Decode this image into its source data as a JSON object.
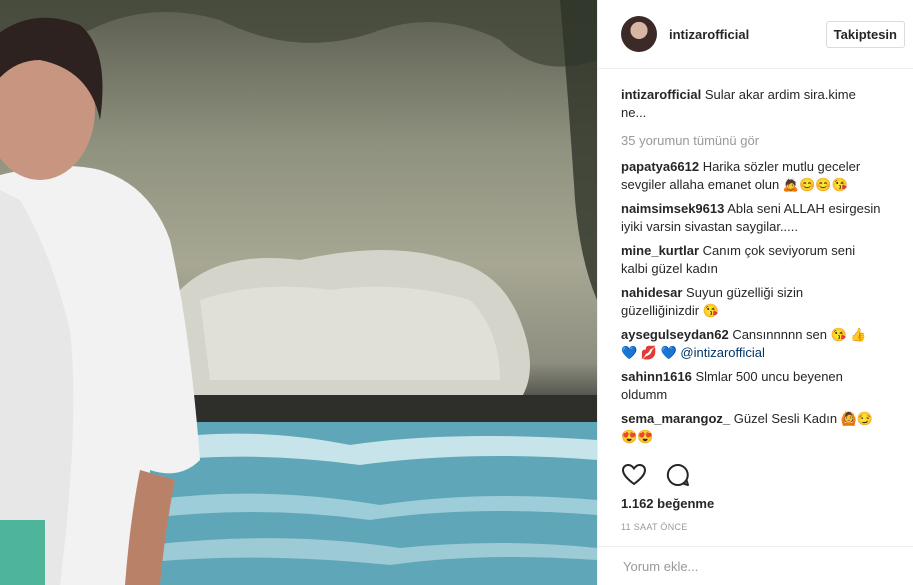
{
  "post": {
    "username": "intizarofficial",
    "follow_label": "Takiptesin",
    "caption_user": "intizarofficial",
    "caption_text": "Sular akar ardim sira.kime ne...",
    "view_all": "35 yorumun tümünü gör",
    "likes": "1.162 beğenme",
    "time": "11 SAAT ÖNCE",
    "comment_placeholder": "Yorum ekle..."
  },
  "comments": [
    {
      "user": "papatya6612",
      "text": "Harika sözler mutlu geceler sevgiler allaha emanet olun",
      "emoji": "🙇😊😊😘"
    },
    {
      "user": "naimsimsek9613",
      "text": "Abla seni ALLAH esirgesin iyiki varsin sivastan saygilar.....",
      "emoji": ""
    },
    {
      "user": "mine_kurtlar",
      "text": "Canım çok seviyorum seni kalbi güzel kadın",
      "emoji": ""
    },
    {
      "user": "nahidesar",
      "text": "Suyun güzelliği sizin güzelliğinizdir",
      "emoji": "😘"
    },
    {
      "user": "aysegulseydan62",
      "text": "Cansınnnnn sen",
      "emoji": "😘 👍 💙 💋 💙",
      "mention": "@intizarofficial"
    },
    {
      "user": "sahinn1616",
      "text": "Slmlar 500 uncu beyenen oldumm",
      "emoji": ""
    },
    {
      "user": "sema_marangoz_",
      "text": "Güzel Sesli Kadın",
      "emoji": "🙆😏 😍😍"
    }
  ],
  "icons": {
    "like": "heart-icon",
    "comment": "comment-icon"
  }
}
